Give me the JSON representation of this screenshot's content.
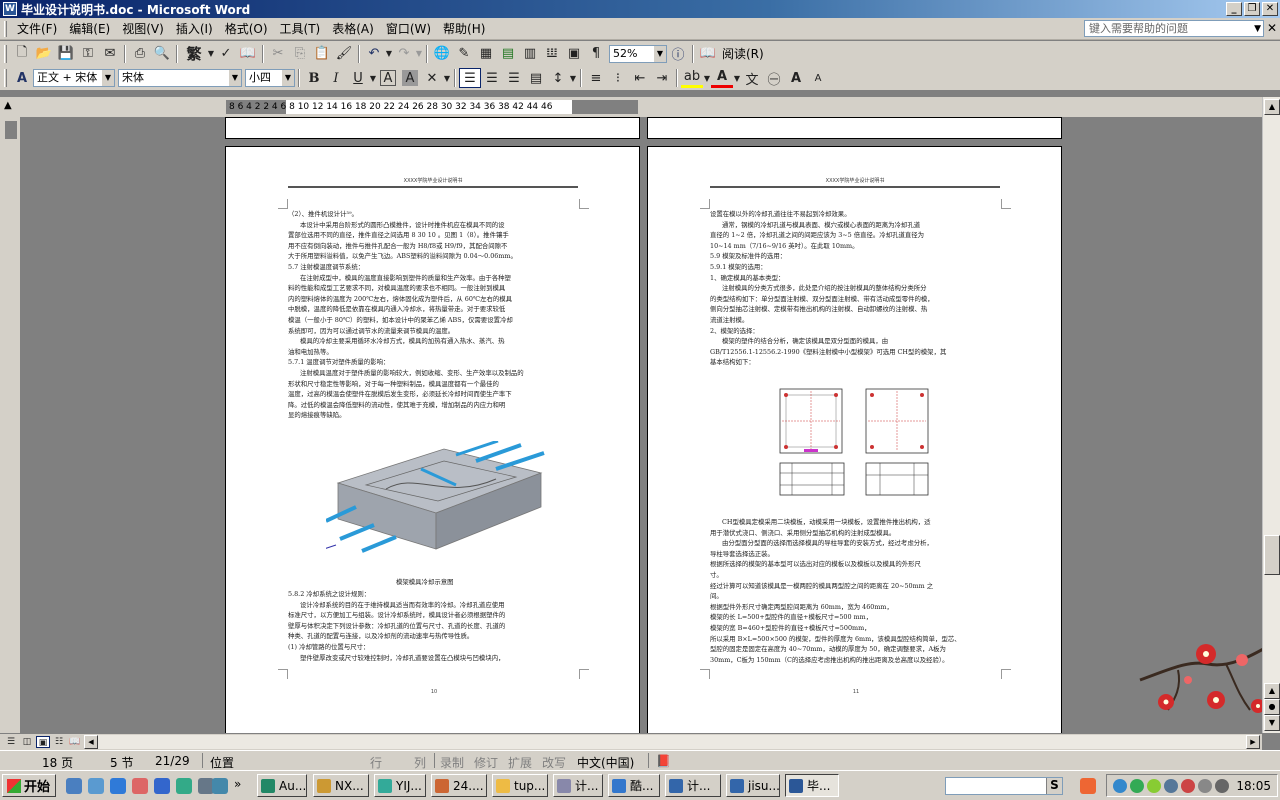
{
  "window": {
    "title": "毕业设计说明书.doc - Microsoft Word",
    "app_icon": "W"
  },
  "menu": {
    "items": [
      "文件(F)",
      "编辑(E)",
      "视图(V)",
      "插入(I)",
      "格式(O)",
      "工具(T)",
      "表格(A)",
      "窗口(W)",
      "帮助(H)"
    ],
    "help_placeholder": "键入需要帮助的问题"
  },
  "toolbar1": {
    "traditional_label": "繁",
    "zoom": "52%",
    "read_label": "阅读(R)"
  },
  "toolbar2": {
    "style": "正文 + 宋体",
    "font": "宋体",
    "size": "小四",
    "bold": "B",
    "italic": "I",
    "underline": "U",
    "font_color_label": "A",
    "wen_label": "文"
  },
  "ruler": {
    "ticks": "8  6  4  2    2  4  6  8  10 12 14 16 18 20 22 24 26 28 30 32 34 36 38      42 44 46"
  },
  "page_left": {
    "header": "XXXX学院毕业设计说明书",
    "page_number": "10",
    "lines": [
      "（2）、推件机设计计³⁹。",
      "本设计中采用台阶形式的圆形凸模推件，设计时推件机应在模具不同的设",
      "置部位选用不同的直径，推件直径之间选用 8 30 10 。见图 1（8）。推件镶手",
      "用不应有倒向装动，推件与推件孔配合一般为 H8/f8或 H9/f9，其配合间隙不",
      "大于所用塑料溢料值，以免产生飞边。ABS塑料的溢料间隙为 0.04～0.06mm。",
      "5.7  注射模温度调节系统：",
      "在注射成型中，模具的温度直接影响到塑件的质量和生产效率。由于各种塑",
      "料的性能和成型工艺要求不同，对模具温度的要求也不相同。一般注射到模具",
      "内的塑料熔体的温度为 200℃左右，熔体固化成为塑件后，从 60℃左右的模具",
      "中脱模，温度的降低是依靠在模具内通入冷却水，将热量带走。对于要求较低",
      "模温（一般小于 80℃）的塑料，如本设计中的聚苯乙烯 ABS，仅需要设置冷却",
      "系统即可，因为可以通过调节水的流量来调节模具的温度。",
      "模具的冷却主要采用循环水冷却方式，模具的加热有通入热水、蒸汽、热",
      "油和电加热等。",
      "5.7.1  温度调节对塑件质量的影响：",
      "注射模具温度对于塑件质量的影响较大，例如收缩、变形、生产效率以及制品的",
      "形状和尺寸稳定性等影响，对于每一种塑料制品，模具温度都有一个最佳的",
      "温度，过高的模温会使塑件在脱模后发生变形，必须延长冷却时间而使生产率下",
      "降。过低的模温会降低塑料的流动性，使其难于充模，增加制品的内应力和明",
      "显的熔接痕等缺陷。"
    ],
    "caption": "模架模具冷却示意图",
    "lines2": [
      "5.8.2  冷却系统之设计规则：",
      "设计冷却系统的目的在于维持模具适当而有效率的冷却。冷却孔道应使用",
      "标准尺寸，以方便加工与组装。设计冷却系统时，模具设计者必须根据塑件的",
      "壁厚与体积决定下列设计参数：冷却孔道的位置与尺寸、孔道的长度、孔道的",
      "种类、孔道的配置与连接，以及冷却剂的流动速率与热传导性质。",
      "(1) 冷却管路的位置与尺寸：",
      "塑件壁厚改变或尺寸较难控制时，冷却孔道要设置在凸模块与凹模块内，"
    ]
  },
  "page_right": {
    "header": "XXXX学院毕业设计说明书",
    "page_number": "11",
    "lines": [
      "设置在模以外的冷却孔道往往不易起到冷却效果。",
      "通常，钢模的冷却孔道与模具表面、模穴或模心表面的距离为冷却孔道",
      "直径的 1~2 倍，冷却孔道之间的间距应该为 3~5 倍直径。冷却孔道直径为",
      "10~14 mm（7/16~9/16 英吋）。在此取 10mm。",
      "5.9  模架及标准件的选用：",
      "5.9.1  模架的选用：",
      "1、确定模具的基本类型：",
      "注射模具的分类方式很多，此处是介绍的按注射模具的整体结构分类所分",
      "的类型结构如下：单分型面注射模、双分型面注射模、带有活动成型零件的模，",
      "侧向分型抽芯注射模、定模带有推出机构的注射模、自动卸螺纹的注射模、热",
      "流道注射模。",
      "2、模架的选择：",
      "模架的塑件的结合分析，确定该模具是双分型面的模具，由",
      "GB/T12556.1-12556.2-1990《塑料注射模中小型模架》可选用 CH型的模架，其",
      "基本结构如下："
    ],
    "lines2": [
      "CH型模具定模采用二块模板，动模采用一块模板，设置推件推出机构，适",
      "用于潜伏式浇口、侧浇口、采用侧分型抽芯机构的注射成型模具。",
      "由分型面分型面的选择而选择模具的导柱导套的安装方式，经过考虑分析，",
      "导柱导套选择选正装。",
      "根据所选择的模架的基本型可以选出对应的模板以及模板以及模具的外形尺",
      "寸。",
      "经过计算可以知道该模具是一模两腔的模具两型腔之间的距离在 20~50mm 之",
      "间。",
      "根据型件外形尺寸确定两型腔间距离为 60mm，宽为 460mm，",
      "模架的长 L=500+型腔件的直径+模板尺寸=500 mm，",
      "模架的宽 B=460+型腔件的直径+模板尺寸=500mm，",
      "所以采用 B×L=500×500 的模架，型件的厚度为 6mm，该模具型腔结构简单，型芯、",
      "型腔的固定是固定在高度为 40~70mm，动模的厚度为 50，确定调整要求，A板为",
      "30mm，C板为 150mm（C的选择应考虑推出机构的推出距离及总高度以及经验）。"
    ]
  },
  "statusbar": {
    "page": "18 页",
    "section": "5 节",
    "position": "21/29",
    "at": "位置",
    "line": "行",
    "col": "列",
    "rec": "录制",
    "trk": "修订",
    "ext": "扩展",
    "ovr": "改写",
    "lang": "中文(中国)"
  },
  "taskbar": {
    "start": "开始",
    "tasks": [
      "Au...",
      "NX...",
      "YIJ...",
      "24....",
      "tup...",
      "计...",
      "酷...",
      "计...",
      "jisu...",
      "毕..."
    ],
    "search_btn": "S",
    "clock": "18:05"
  },
  "colors": {
    "title_start": "#0a246a",
    "title_end": "#a6caf0",
    "chrome": "#d4d0c8",
    "doc_bg": "#808080",
    "pipe_blue": "#2a9ad8"
  }
}
